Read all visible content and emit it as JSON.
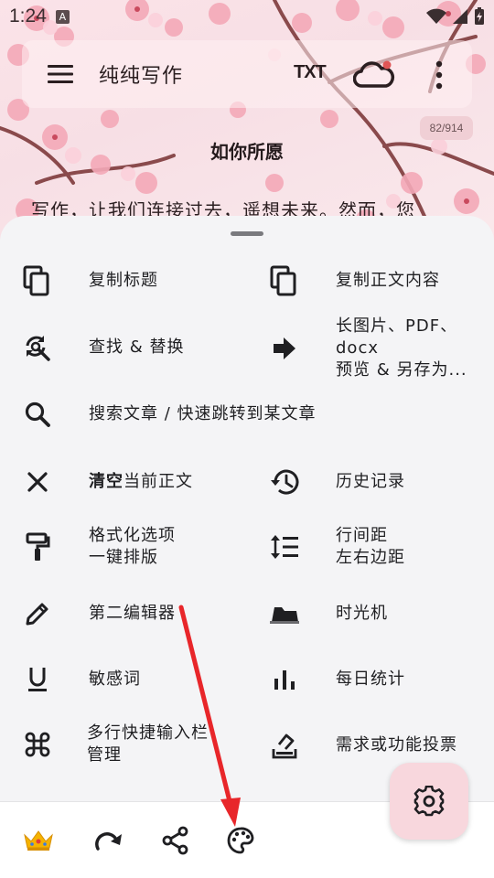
{
  "status_bar": {
    "time": "1:24",
    "notification_badge": "A"
  },
  "app_bar": {
    "title": "纯纯写作",
    "txt_label": "TXT"
  },
  "document": {
    "word_count": "82/914",
    "title": "如你所愿",
    "body_preview": "写作，让我们连接过去，遥想未来。然而，您"
  },
  "menu": {
    "copy_title": "复制标题",
    "copy_body": "复制正文内容",
    "find_replace": "查找 & 替换",
    "export_line1": "长图片、PDF、",
    "export_line2": "docx",
    "export_line3": "预览 & 另存为...",
    "search_articles": "搜索文章 / 快速跳转到某文章",
    "clear_bold": "清空",
    "clear_rest": "当前正文",
    "history": "历史记录",
    "format_line1": "格式化选项",
    "format_line2": "一键排版",
    "spacing_line1": "行间距",
    "spacing_line2": "左右边距",
    "second_editor": "第二编辑器",
    "time_machine": "时光机",
    "sensitive_words": "敏感词",
    "daily_stats": "每日统计",
    "multiline_line1": "多行快捷输入栏",
    "multiline_line2": "管理",
    "feature_vote": "需求或功能投票"
  },
  "bottom_bar": {
    "icons": [
      "crown-icon",
      "redo-icon",
      "share-icon",
      "palette-icon"
    ]
  },
  "colors": {
    "accent_pink": "#f8d7dd",
    "sheet_bg": "#f4f4f6",
    "annotation_red": "#e8262a"
  }
}
